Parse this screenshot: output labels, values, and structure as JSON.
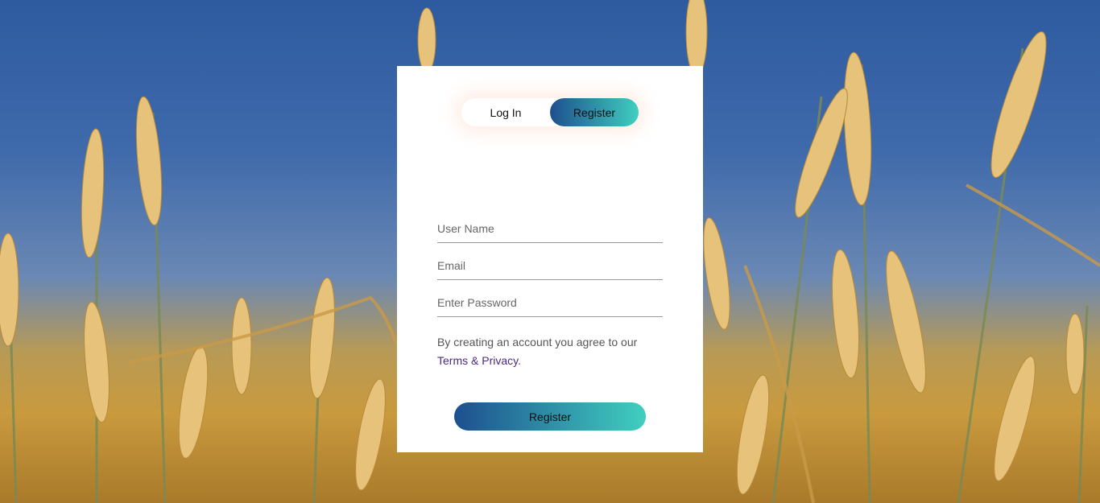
{
  "background": {
    "description_icon": "wheat-field-background",
    "sky_color": "#2e5aa0",
    "field_color": "#c99a3e"
  },
  "toggle": {
    "login_label": "Log In",
    "register_label": "Register",
    "active": "register",
    "active_gradient": [
      "#1d4f8f",
      "#40cfbf"
    ]
  },
  "form": {
    "username_placeholder": "User Name",
    "email_placeholder": "Email",
    "password_placeholder": "Enter Password",
    "terms_text": "By creating an account you agree to our ",
    "terms_link": "Terms & Privacy",
    "terms_suffix": ".",
    "submit_label": "Register"
  }
}
